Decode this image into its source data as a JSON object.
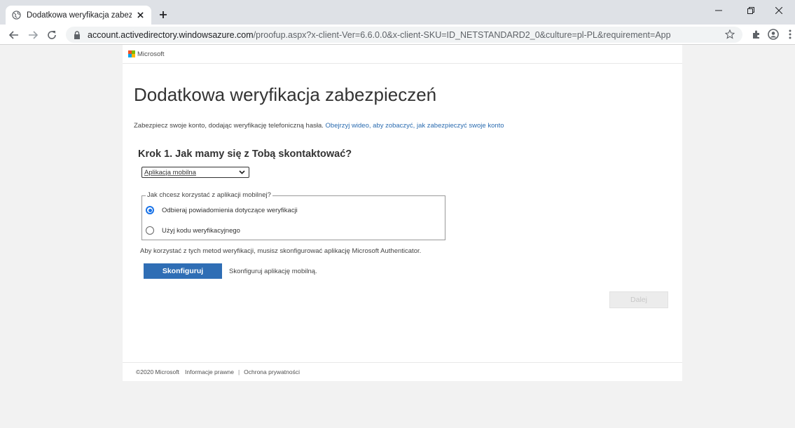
{
  "browser": {
    "tab_title": "Dodatkowa weryfikacja zabezpiec",
    "url_host": "account.activedirectory.windowsazure.com",
    "url_path": "/proofup.aspx?x-client-Ver=6.6.0.0&x-client-SKU=ID_NETSTANDARD2_0&culture=pl-PL&requirement=App",
    "icons": [
      "globe-icon",
      "close-icon",
      "plus-icon",
      "back-icon",
      "forward-icon",
      "reload-icon",
      "lock-icon",
      "star-icon",
      "extensions-icon",
      "profile-icon",
      "menu-icon",
      "minimize-icon",
      "restore-icon"
    ]
  },
  "header": {
    "brand": "Microsoft",
    "logo_colors": [
      "#f25022",
      "#7fba00",
      "#00a4ef",
      "#ffb900"
    ]
  },
  "main": {
    "title": "Dodatkowa weryfikacja zabezpieczeń",
    "intro_text": "Zabezpiecz swoje konto, dodając weryfikację telefoniczną hasła.",
    "intro_link": "Obejrzyj wideo, aby zobaczyć, jak zabezpieczyć swoje konto",
    "step_title": "Krok 1. Jak mamy się z Tobą skontaktować?",
    "method_select": "Aplikacja mobilna",
    "fieldset_legend": "Jak chcesz korzystać z aplikacji mobilnej?",
    "radio_notify": "Odbieraj powiadomienia dotyczące weryfikacji",
    "radio_code": "Użyj kodu weryfikacyjnego",
    "info_text": "Aby korzystać z tych metod weryfikacji, musisz skonfigurować aplikację Microsoft Authenticator.",
    "configure_button": "Skonfiguruj",
    "configure_desc": "Skonfiguruj aplikację mobilną.",
    "next_button": "Dalej"
  },
  "footer": {
    "copyright": "©2020 Microsoft",
    "legal": "Informacje prawne",
    "separator": "|",
    "privacy": "Ochrona prywatności"
  },
  "colors": {
    "primary": "#2f6eb5",
    "link": "#2b6cb0",
    "radio_checked": "#1a73e8"
  }
}
